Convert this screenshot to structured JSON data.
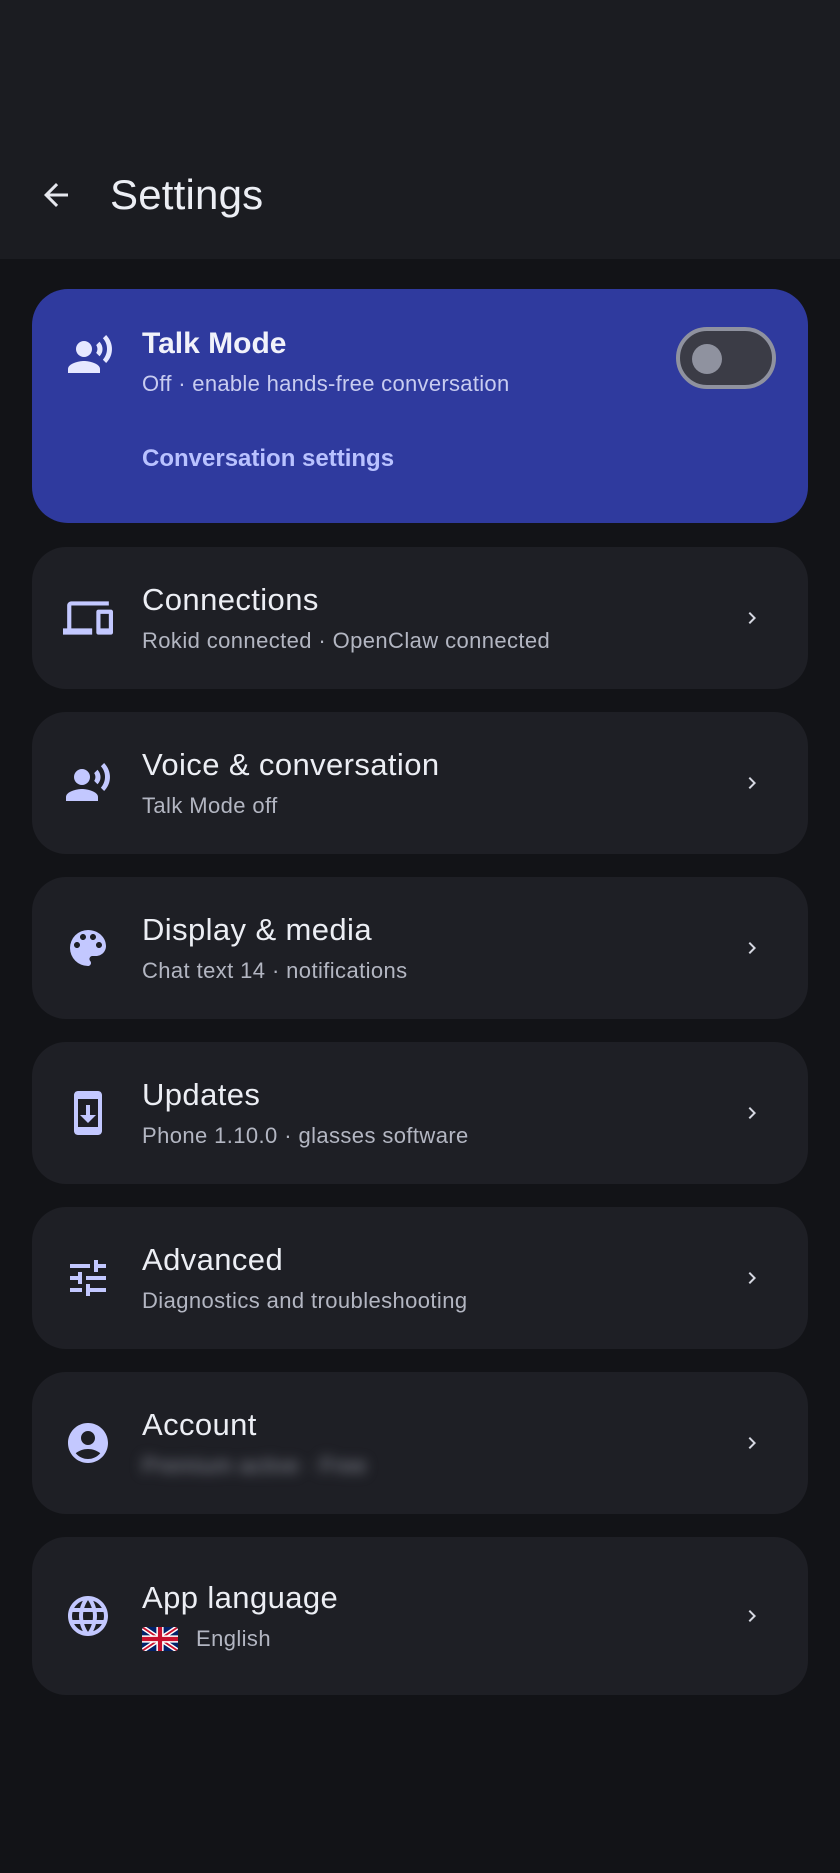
{
  "header": {
    "title": "Settings"
  },
  "talk_mode": {
    "title": "Talk Mode",
    "subtitle": "Off · enable hands-free conversation",
    "link": "Conversation settings",
    "toggle_on": false
  },
  "items": [
    {
      "icon": "devices-icon",
      "title": "Connections",
      "subtitle": "Rokid connected · OpenClaw connected"
    },
    {
      "icon": "voice-icon",
      "title": "Voice & conversation",
      "subtitle": "Talk Mode off"
    },
    {
      "icon": "palette-icon",
      "title": "Display & media",
      "subtitle": "Chat text 14 · notifications"
    },
    {
      "icon": "phone-update-icon",
      "title": "Updates",
      "subtitle": "Phone 1.10.0 · glasses software"
    },
    {
      "icon": "tune-icon",
      "title": "Advanced",
      "subtitle": "Diagnostics and troubleshooting"
    },
    {
      "icon": "account-icon",
      "title": "Account",
      "subtitle": "Premium active · Free"
    },
    {
      "icon": "globe-icon",
      "title": "App language",
      "subtitle": "English",
      "flag": "uk-flag-icon"
    }
  ],
  "colors": {
    "background": "#121317",
    "card": "#1e1f25",
    "accent_card": "#2f3a9e",
    "icon": "#c3c8ff",
    "link": "#b9c2ff"
  }
}
